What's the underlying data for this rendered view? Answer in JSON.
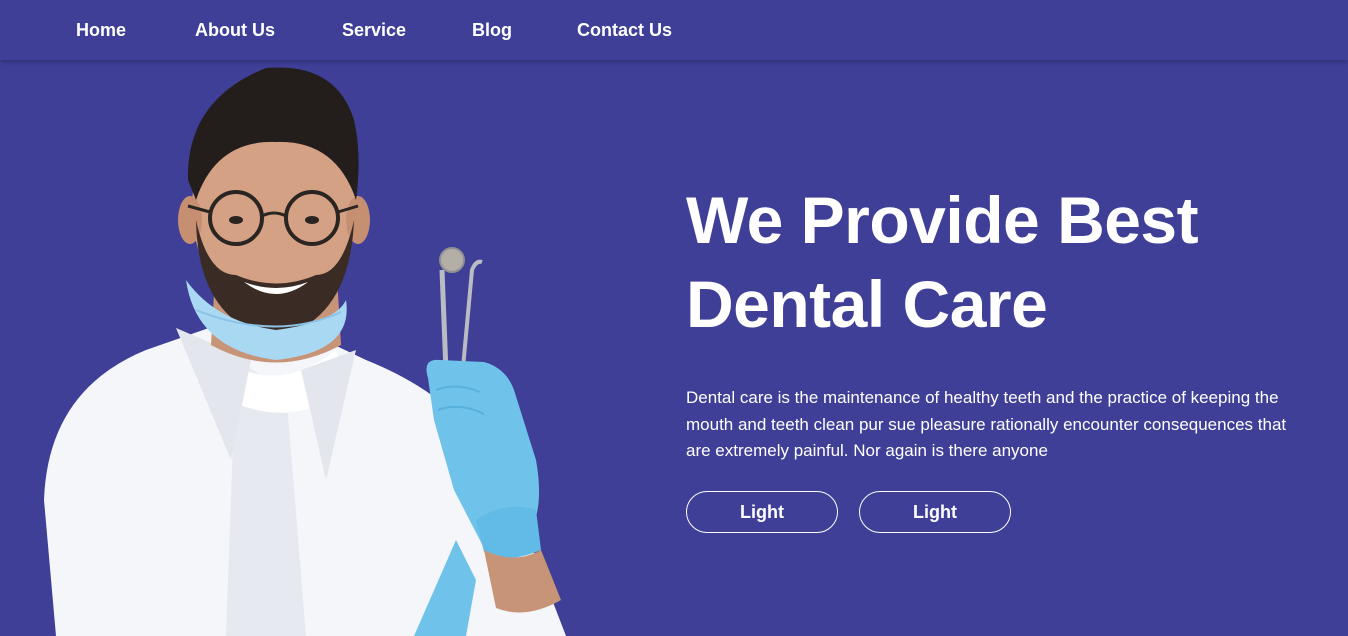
{
  "nav": {
    "items": [
      {
        "label": "Home"
      },
      {
        "label": "About Us"
      },
      {
        "label": "Service"
      },
      {
        "label": "Blog"
      },
      {
        "label": "Contact Us"
      }
    ]
  },
  "hero": {
    "title_line1": "We Provide Best",
    "title_line2": "Dental Care",
    "description": "Dental care is the maintenance of healthy teeth and the practice of keeping the mouth and teeth clean pur sue pleasure rationally encounter consequences that are extremely painful. Nor again is there anyone",
    "buttons": [
      {
        "label": "Light"
      },
      {
        "label": "Light"
      }
    ]
  },
  "colors": {
    "background": "#3f3f97",
    "text": "#ffffff",
    "glove": "#6fc3ea",
    "mask": "#a9d8f2"
  }
}
